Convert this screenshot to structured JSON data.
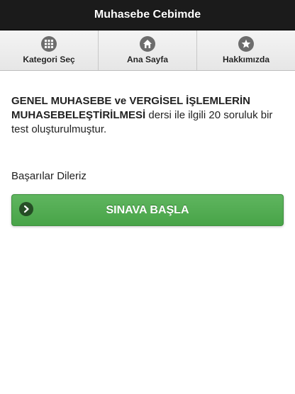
{
  "header": {
    "title": "Muhasebe Cebimde"
  },
  "nav": {
    "items": [
      {
        "label": "Kategori Seç",
        "icon": "grid-icon"
      },
      {
        "label": "Ana Sayfa",
        "icon": "home-icon"
      },
      {
        "label": "Hakkımızda",
        "icon": "star-icon"
      }
    ]
  },
  "content": {
    "intro_bold": "GENEL MUHASEBE ve VERGİSEL İŞLEMLERİN MUHASEBELEŞTİRİLMESİ",
    "intro_rest": " dersi ile ilgili 20 soruluk bir test oluşturulmuştur.",
    "greeting": "Başarılar Dileriz",
    "start_button": "SINAVA BAŞLA"
  },
  "colors": {
    "header_bg": "#1b1b1b",
    "button_green": "#55ad55"
  }
}
